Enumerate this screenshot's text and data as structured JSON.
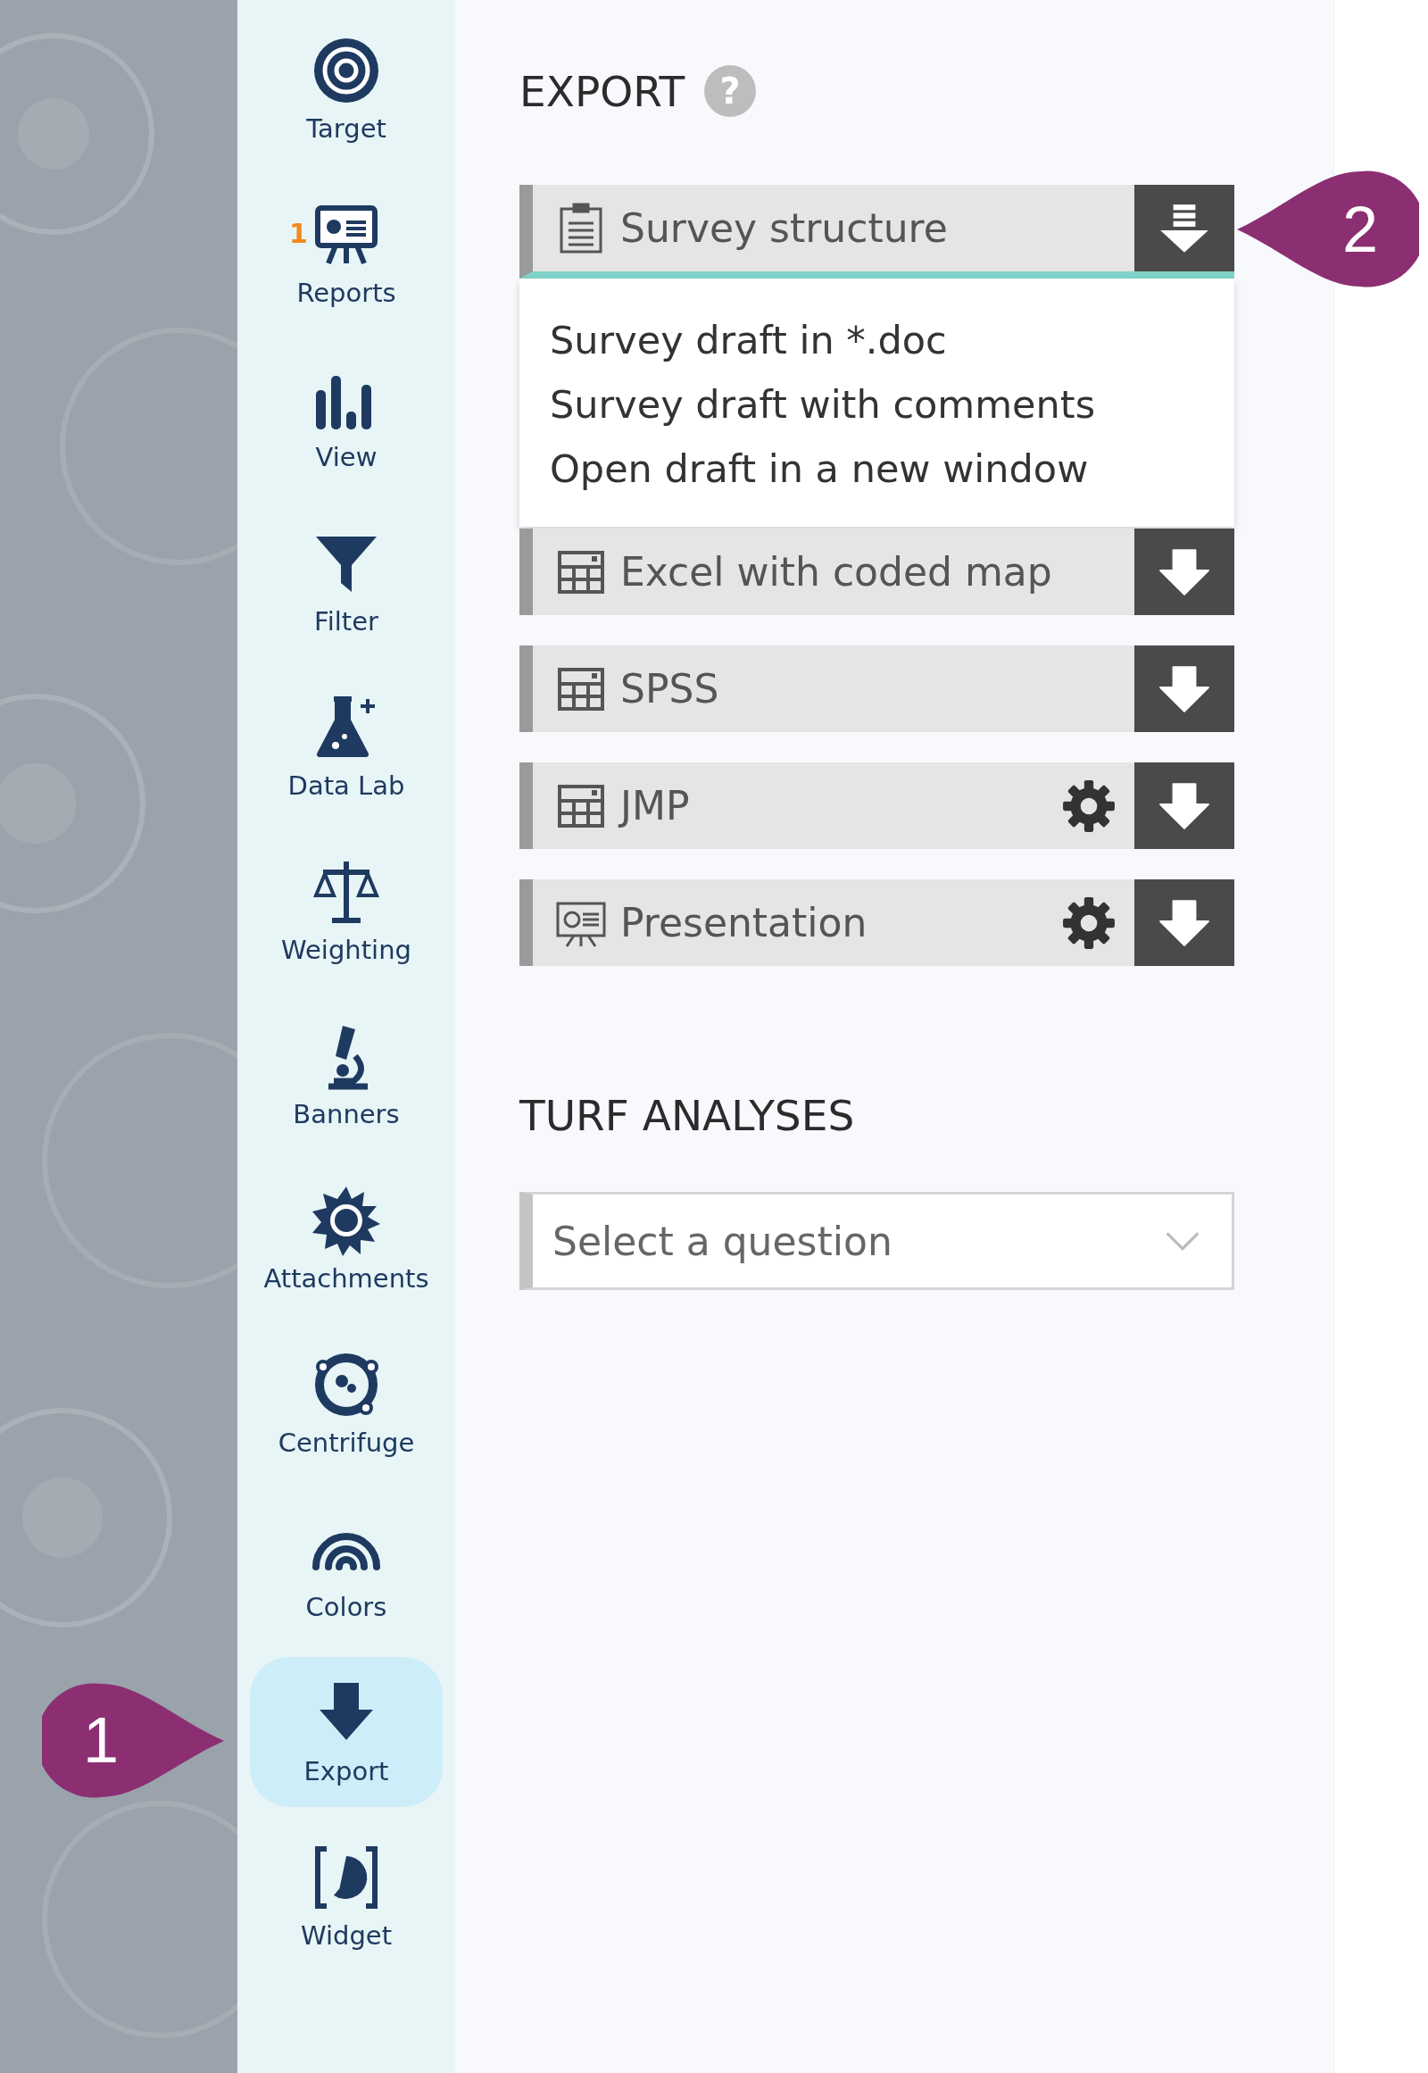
{
  "sidebar": {
    "items": [
      {
        "label": "Target",
        "kind": "target",
        "selected": false
      },
      {
        "label": "Reports",
        "kind": "reports",
        "selected": false,
        "badge": "1"
      },
      {
        "label": "View",
        "kind": "view",
        "selected": false
      },
      {
        "label": "Filter",
        "kind": "filter",
        "selected": false
      },
      {
        "label": "Data Lab",
        "kind": "flask",
        "selected": false
      },
      {
        "label": "Weighting",
        "kind": "scale",
        "selected": false
      },
      {
        "label": "Banners",
        "kind": "microscope",
        "selected": false
      },
      {
        "label": "Attachments",
        "kind": "sun",
        "selected": false
      },
      {
        "label": "Centrifuge",
        "kind": "centrifuge",
        "selected": false
      },
      {
        "label": "Colors",
        "kind": "rainbow",
        "selected": false
      },
      {
        "label": "Export",
        "kind": "export",
        "selected": true
      },
      {
        "label": "Widget",
        "kind": "widget",
        "selected": false
      }
    ]
  },
  "export": {
    "title": "EXPORT",
    "help": "?",
    "rows": [
      {
        "label": "Survey structure",
        "kind": "clipboard",
        "settings": false,
        "expanded": true,
        "menu": [
          "Survey draft in *.doc",
          "Survey draft with comments",
          "Open draft in a new window"
        ]
      },
      {
        "label": "Excel with coded map",
        "kind": "table",
        "settings": false,
        "expanded": false
      },
      {
        "label": "SPSS",
        "kind": "table",
        "settings": false,
        "expanded": false
      },
      {
        "label": "JMP",
        "kind": "table",
        "settings": true,
        "expanded": false
      },
      {
        "label": "Presentation",
        "kind": "presentation",
        "settings": true,
        "expanded": false
      }
    ]
  },
  "turf": {
    "title": "TURF ANALYSES",
    "select": {
      "placeholder": "Select a question"
    }
  },
  "callouts": [
    {
      "label": "1"
    },
    {
      "label": "2"
    }
  ]
}
